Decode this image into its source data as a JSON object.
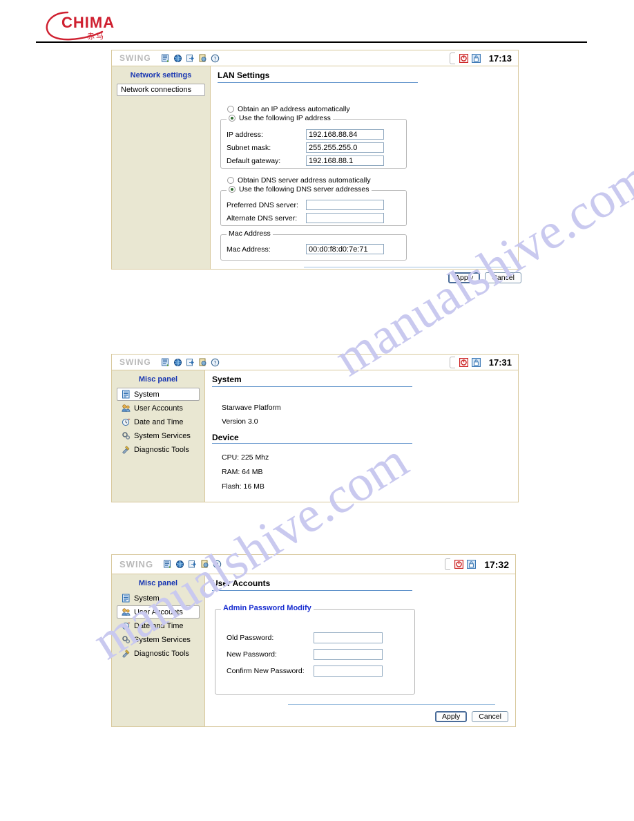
{
  "document": {
    "logo": {
      "brand": "CHIMA",
      "chinese": "赤马",
      "color": "#cf2030"
    },
    "watermark": [
      "manualshive.com",
      "manualshive.com"
    ]
  },
  "toolbar_icons": [
    "device-icon",
    "globe-icon",
    "export-icon",
    "printer-icon",
    "help-icon"
  ],
  "status_icons": [
    "power-icon",
    "lock-icon"
  ],
  "panels": [
    {
      "id": "lan-settings",
      "brand": "SWING",
      "clock": "17:13",
      "sidebar": {
        "title": "Network settings",
        "box_label": "Network connections"
      },
      "content": {
        "title": "LAN Settings",
        "ip_mode": {
          "auto_label": "Obtain an IP address automatically",
          "manual_label": "Use the following IP address",
          "selected": "manual"
        },
        "ip_fields": [
          {
            "label": "IP address:",
            "value": "192.168.88.84"
          },
          {
            "label": "Subnet mask:",
            "value": "255.255.255.0"
          },
          {
            "label": "Default gateway:",
            "value": "192.168.88.1"
          }
        ],
        "dns_mode": {
          "auto_label": "Obtain DNS server address automatically",
          "manual_label": "Use the following DNS server addresses",
          "selected": "manual"
        },
        "dns_fields": [
          {
            "label": "Preferred DNS server:",
            "value": ""
          },
          {
            "label": "Alternate DNS server:",
            "value": ""
          }
        ],
        "mac_group": {
          "legend": "Mac Address",
          "label": "Mac Address:",
          "value": "00:d0:f8:d0:7e:71"
        },
        "buttons": {
          "apply": "Apply",
          "cancel": "Cancel"
        }
      }
    },
    {
      "id": "system",
      "brand": "SWING",
      "clock": "17:31",
      "sidebar": {
        "title": "Misc panel",
        "items": [
          {
            "label": "System",
            "icon": "system-icon",
            "selected": true
          },
          {
            "label": "User Accounts",
            "icon": "users-icon",
            "selected": false
          },
          {
            "label": "Date and Time",
            "icon": "clock-icon",
            "selected": false
          },
          {
            "label": "System Services",
            "icon": "services-icon",
            "selected": false
          },
          {
            "label": "Diagnostic Tools",
            "icon": "tools-icon",
            "selected": false
          }
        ]
      },
      "content": {
        "title": "System",
        "platform": "Starwave Platform",
        "version": "Version 3.0",
        "device_title": "Device",
        "device": [
          "CPU: 225 Mhz",
          "RAM: 64 MB",
          "Flash: 16 MB"
        ]
      }
    },
    {
      "id": "user-accounts",
      "brand": "SWING",
      "clock": "17:32",
      "sidebar": {
        "title": "Misc panel",
        "items": [
          {
            "label": "System",
            "icon": "system-icon",
            "selected": false
          },
          {
            "label": "User Accounts",
            "icon": "users-icon",
            "selected": true
          },
          {
            "label": "Date and Time",
            "icon": "clock-icon",
            "selected": false
          },
          {
            "label": "System Services",
            "icon": "services-icon",
            "selected": false
          },
          {
            "label": "Diagnostic Tools",
            "icon": "tools-icon",
            "selected": false
          }
        ]
      },
      "content": {
        "title": "User Accounts",
        "group_legend": "Admin Password Modify",
        "fields": [
          {
            "label": "Old Password:",
            "value": ""
          },
          {
            "label": "New Password:",
            "value": ""
          },
          {
            "label": "Confirm New Password:",
            "value": ""
          }
        ],
        "buttons": {
          "apply": "Apply",
          "cancel": "Cancel"
        }
      }
    }
  ]
}
